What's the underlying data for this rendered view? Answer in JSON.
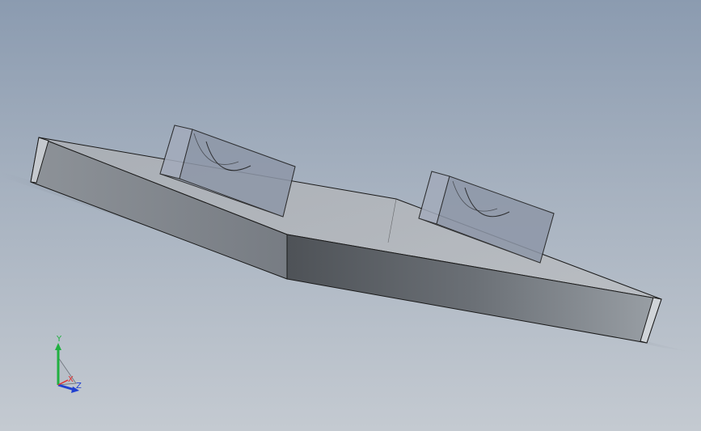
{
  "viewport": {
    "background_top": "#8b9bb0",
    "background_bottom": "#c4cad1"
  },
  "model": {
    "part_color": "#a9adb3",
    "edge_color": "#1a1a1a",
    "transparent_block_color": "#9aa3b4"
  },
  "triad": {
    "x_label": "X",
    "y_label": "Y",
    "z_label": "Z",
    "x_color": "#e03030",
    "y_color": "#20b040",
    "z_color": "#2040d0"
  }
}
